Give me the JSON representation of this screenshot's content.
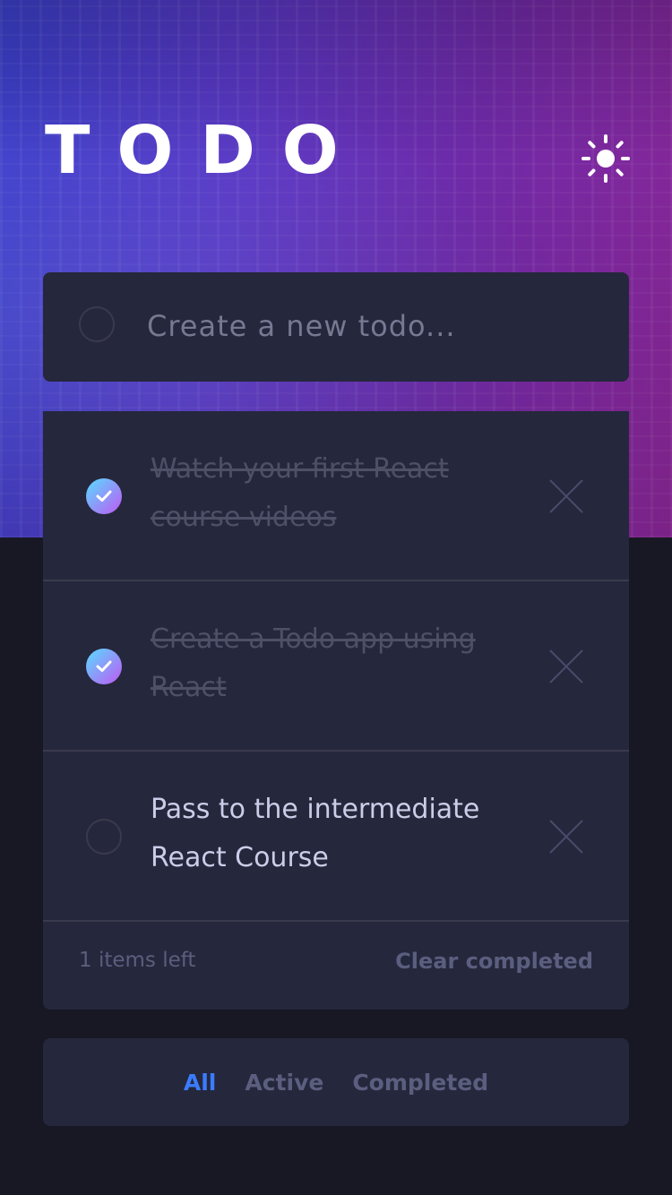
{
  "header": {
    "title": "TODO",
    "theme_toggle_icon": "sun-icon"
  },
  "new_todo": {
    "placeholder": "Create a new todo..."
  },
  "todos": [
    {
      "text": "Watch your first React course videos",
      "completed": true
    },
    {
      "text": "Create a Todo app using React",
      "completed": true
    },
    {
      "text": "Pass to the intermediate React Course",
      "completed": false
    }
  ],
  "footer": {
    "items_left": "1 items left",
    "clear_label": "Clear completed"
  },
  "filters": {
    "all": "All",
    "active": "Active",
    "completed": "Completed",
    "selected": "All"
  },
  "colors": {
    "accent": "#3a7cfd",
    "check_gradient_start": "#57ddff",
    "check_gradient_end": "#c058f3",
    "card_bg": "#25273c",
    "page_bg": "#171824"
  }
}
